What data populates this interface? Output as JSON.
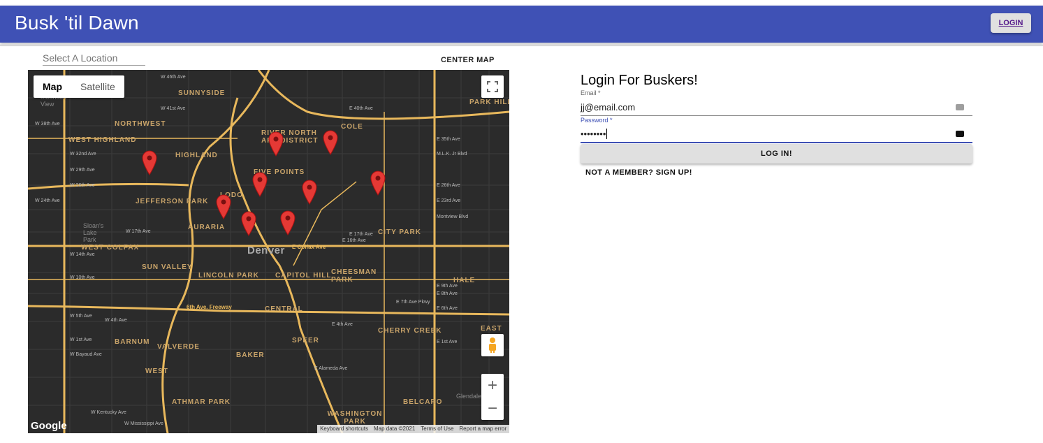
{
  "app": {
    "title": "Busk 'til Dawn",
    "login_label": "LOGIN"
  },
  "location": {
    "placeholder": "Select A Location",
    "center_map_label": "CENTER MAP"
  },
  "map": {
    "type_options": [
      "Map",
      "Satellite"
    ],
    "selected_type": "Map",
    "city_label": "Denver",
    "neighborhoods": [
      "SUNNYSIDE",
      "NORTHWEST",
      "WEST HIGHLAND",
      "HIGHLAND",
      "RIVER NORTH ART DISTRICT",
      "COLE",
      "FIVE POINTS",
      "LODO",
      "JEFFERSON PARK",
      "AURARIA",
      "CITY PARK",
      "WEST COLFAX",
      "SUN VALLEY",
      "LINCOLN PARK",
      "CAPITOL HILL",
      "CHEESMAN PARK",
      "HALE",
      "CENTRAL",
      "CHERRY CREEK",
      "BARNUM",
      "VALVERDE",
      "SPEER",
      "BAKER",
      "EAST",
      "WEST",
      "ATHMAR PARK",
      "WASHINGTON PARK",
      "BELCARO",
      "PARK HILL"
    ],
    "streets": [
      "W 46th Ave",
      "W 41st Ave",
      "W 38th Ave",
      "W 32nd Ave",
      "W 29th Ave",
      "W 26th Ave",
      "W 24th Ave",
      "W 17th Ave",
      "W 14th Ave",
      "W 10th Ave",
      "W 5th Ave",
      "W 4th Ave",
      "W 1st Ave",
      "W Bayaud Ave",
      "E 40th Ave",
      "E 35th Ave",
      "M.L.K. Jr Blvd",
      "E 26th Ave",
      "E 23rd Ave",
      "E 17th Ave",
      "E 16th Ave",
      "E Colfax Ave",
      "E 9th Ave",
      "E 8th Ave",
      "E 6th Ave",
      "E 4th Ave",
      "E 1st Ave",
      "E Alameda Ave",
      "W Kentucky Ave",
      "W Mississippi Ave",
      "6th Ave. Freeway",
      "Montview Blvd",
      "E 7th Ave Pkwy"
    ],
    "place_labels": [
      "Sloan's Lake Park",
      "Glendale",
      "Mountain View"
    ],
    "marker_count": 9,
    "google_label": "Google",
    "attribution": [
      "Keyboard shortcuts",
      "Map data ©2021",
      "Terms of Use",
      "Report a map error"
    ]
  },
  "login_form": {
    "title": "Login For Buskers!",
    "email_label": "Email *",
    "email_value": "jj@email.com",
    "password_label": "Password *",
    "password_value": "••••••••",
    "submit_label": "LOG IN!",
    "signup_label": "NOT A MEMBER? SIGN UP!"
  },
  "colors": {
    "appbar": "#3f51b5",
    "map_bg": "#2b2b2b",
    "highway": "#e8b85c",
    "marker": "#e53935",
    "focus": "#3f51b5"
  }
}
